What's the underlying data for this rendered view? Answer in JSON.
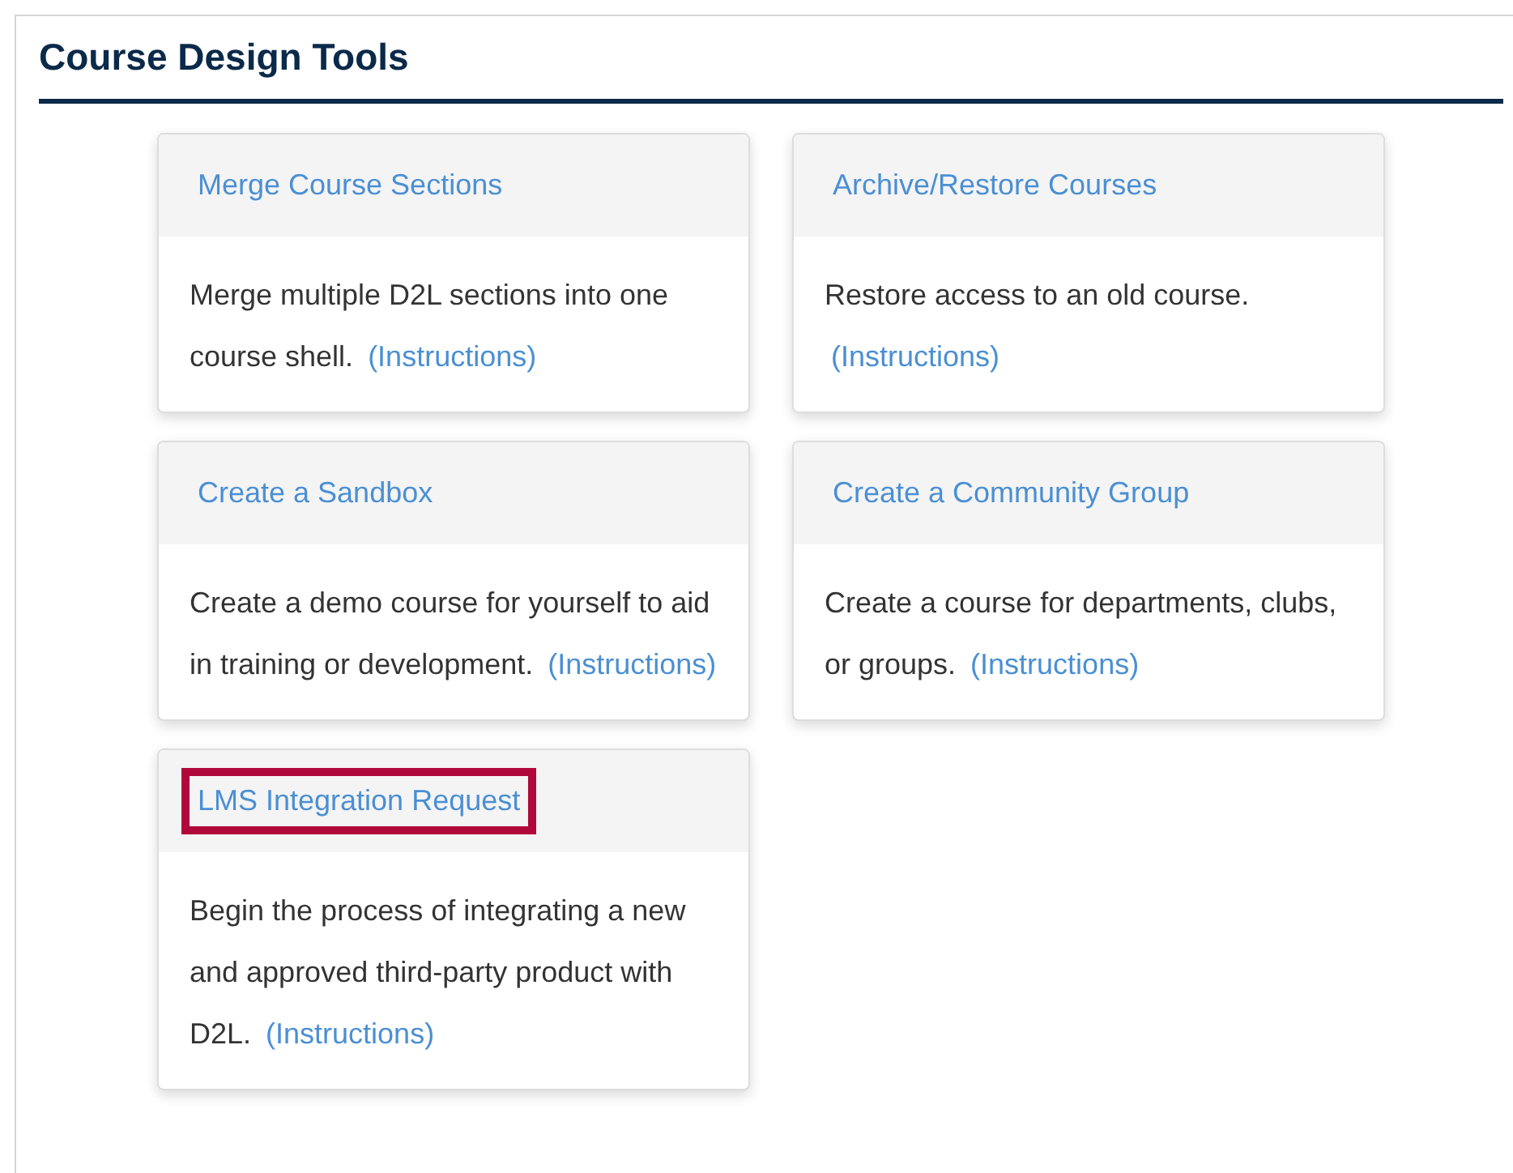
{
  "title": "Course Design Tools",
  "cards": [
    {
      "title": "Merge Course Sections",
      "description": "Merge multiple D2L sections into one course shell.",
      "link": "(Instructions)",
      "highlighted": false
    },
    {
      "title": "Archive/Restore Courses",
      "description": "Restore access to an old course.",
      "link": "(Instructions)",
      "highlighted": false
    },
    {
      "title": "Create a Sandbox",
      "description": "Create a demo course for yourself to aid in training or development.",
      "link": "(Instructions)",
      "highlighted": false
    },
    {
      "title": "Create a Community Group",
      "description": "Create a course for departments, clubs, or groups.",
      "link": "(Instructions)",
      "highlighted": false
    },
    {
      "title": "LMS Integration Request",
      "description": "Begin the process of integrating a new and approved third-party product with D2L.",
      "link": "(Instructions)",
      "highlighted": true
    }
  ]
}
